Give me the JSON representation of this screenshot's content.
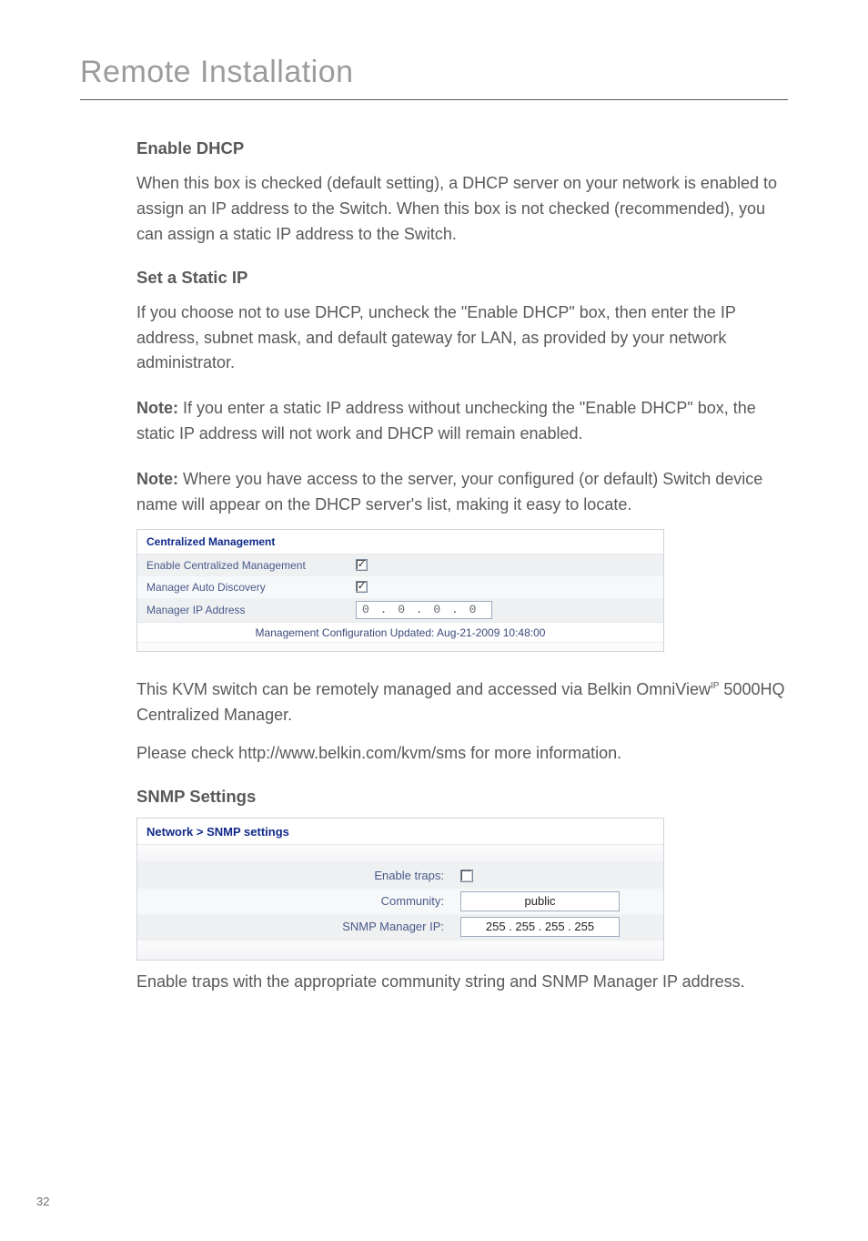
{
  "page_title": "Remote Installation",
  "page_number": "32",
  "sections": {
    "enable_dhcp": {
      "heading": "Enable DHCP",
      "p1": "When this box is checked (default setting), a DHCP server on your network is enabled to assign an IP address to the Switch. When this box is not checked (recommended), you can assign a static IP address to the Switch."
    },
    "static_ip": {
      "heading": "Set a Static IP",
      "p1": "If you choose not to use DHCP, uncheck the \"Enable DHCP\" box, then enter the IP address, subnet mask, and default gateway for LAN, as provided by your network administrator.",
      "note1_label": "Note:",
      "note1": " If you enter a static IP address without unchecking the \"Enable DHCP\" box, the static IP address will not work and DHCP will remain enabled.",
      "note2_label": "Note:",
      "note2": " Where you have access to the server, your configured (or default) Switch device name will appear on the DHCP server's list, making it easy to locate."
    },
    "kvm_para": "This KVM switch can be remotely managed and accessed via Belkin OmniView",
    "kvm_sup": "IP",
    "kvm_para_tail": " 5000HQ Centralized Manager.",
    "please_check": "Please check http://www.belkin.com/kvm/sms for more information.",
    "snmp": {
      "heading": "SNMP Settings",
      "footer": "Enable traps with the appropriate community string and SNMP Manager IP address."
    }
  },
  "cm_panel": {
    "title": "Centralized Management",
    "rows": {
      "enable_cm": "Enable Centralized Management",
      "auto_discovery": "Manager Auto Discovery",
      "ip_addr_label": "Manager IP Address",
      "ip_addr_value": "0 . 0 . 0 . 0"
    },
    "footer": "Management Configuration Updated: Aug-21-2009 10:48:00"
  },
  "snmp_panel": {
    "title": "Network > SNMP settings",
    "enable_traps_label": "Enable traps:",
    "community_label": "Community:",
    "community_value": "public",
    "mgr_ip_label": "SNMP Manager IP:",
    "mgr_ip_value": "255 . 255 . 255 . 255"
  }
}
